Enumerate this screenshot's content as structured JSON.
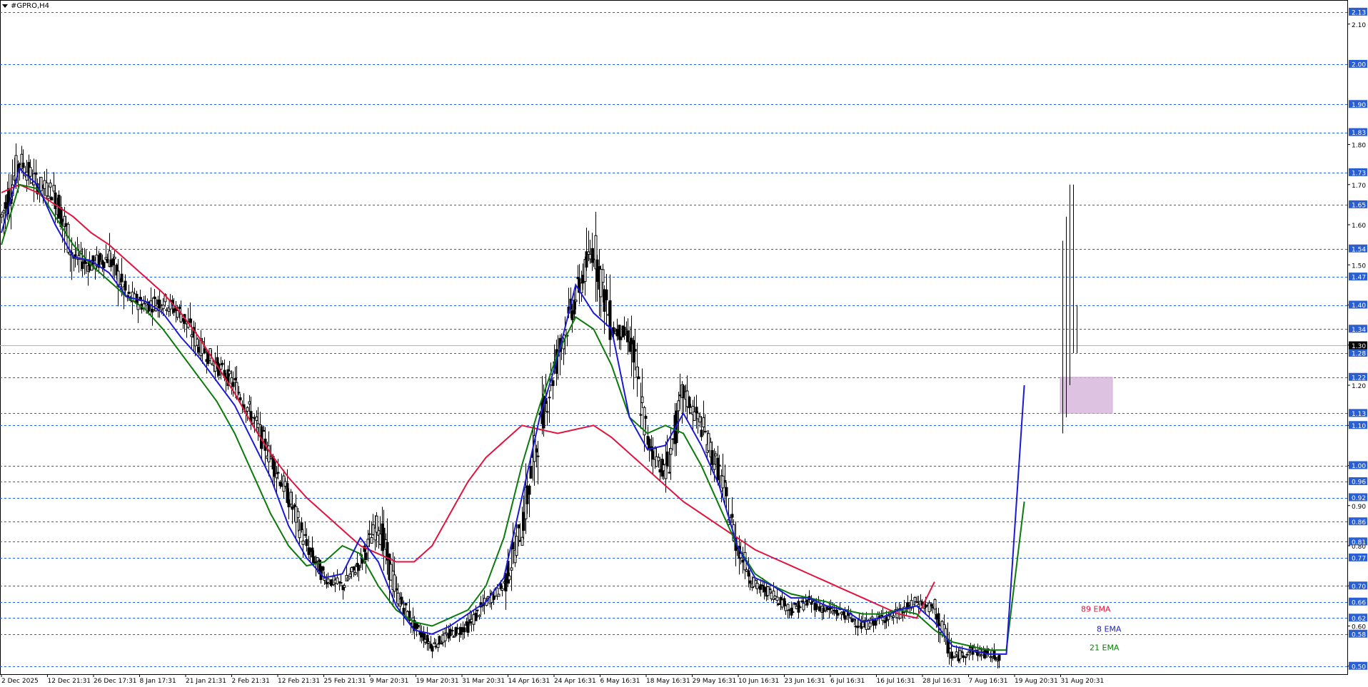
{
  "window": {
    "symbol": "#GPRO,H4"
  },
  "colors": {
    "grid": "#2a5fd3",
    "ema8": "#1a1ad6",
    "ema21": "#0a7a0a",
    "ema89": "#e0143c",
    "zone": "#d8b8dc",
    "current_price_bg": "#000000"
  },
  "price_axis": {
    "min": 0.48,
    "max": 2.16,
    "levels": [
      "2.13",
      "2.00",
      "1.90",
      "1.83",
      "1.73",
      "1.65",
      "1.54",
      "1.47",
      "1.40",
      "1.34",
      "1.28",
      "1.22",
      "1.13",
      "1.10",
      "1.00",
      "0.96",
      "0.92",
      "0.86",
      "0.81",
      "0.77",
      "0.70",
      "0.66",
      "0.62",
      "0.58",
      "0.50"
    ],
    "ticks": [
      "2.10",
      "1.80",
      "1.70",
      "1.60",
      "1.50",
      "1.40",
      "1.30",
      "1.20",
      "1.10",
      "1.00",
      "0.90",
      "0.80",
      "0.70",
      "0.60",
      "0.50"
    ],
    "current_price": "1.30"
  },
  "time_axis": {
    "labels": [
      "2 Dec 2025",
      "12 Dec 21:31",
      "26 Dec 17:31",
      "8 Jan 17:31",
      "21 Jan 21:31",
      "2 Feb 21:31",
      "12 Feb 21:31",
      "25 Feb 21:31",
      "9 Mar 20:31",
      "19 Mar 20:31",
      "31 Mar 20:31",
      "14 Apr 16:31",
      "24 Apr 16:31",
      "6 May 16:31",
      "18 May 16:31",
      "29 May 16:31",
      "10 Jun 16:31",
      "23 Jun 16:31",
      "6 Jul 16:31",
      "16 Jul 16:31",
      "28 Jul 16:31",
      "7 Aug 16:31",
      "19 Aug 20:31",
      "31 Aug 20:31"
    ]
  },
  "legend": {
    "ema89": "89 EMA",
    "ema8": "8 EMA",
    "ema21": "21 EMA"
  },
  "chart_data": {
    "type": "line",
    "title": "#GPRO,H4",
    "ylim": [
      0.48,
      2.16
    ],
    "x": [
      0,
      10,
      20,
      30,
      40,
      50,
      60,
      70,
      80,
      90,
      100,
      110,
      120,
      130,
      140,
      150,
      160,
      170,
      180,
      190,
      200,
      210,
      220,
      230,
      240,
      250,
      260,
      270,
      280,
      290,
      300,
      310,
      320,
      330,
      340,
      350,
      360,
      370,
      380,
      390,
      400,
      410,
      420,
      430,
      440,
      450,
      460,
      470,
      480,
      490,
      500,
      510,
      520,
      530,
      540,
      550,
      560,
      570,
      580,
      590,
      600
    ],
    "price": [
      1.62,
      1.76,
      1.7,
      1.68,
      1.52,
      1.5,
      1.52,
      1.42,
      1.4,
      1.41,
      1.38,
      1.3,
      1.25,
      1.2,
      1.12,
      1.02,
      0.92,
      0.8,
      0.72,
      0.7,
      0.76,
      0.86,
      0.68,
      0.6,
      0.55,
      0.58,
      0.6,
      0.66,
      0.7,
      0.85,
      1.1,
      1.28,
      1.42,
      1.55,
      1.34,
      1.32,
      1.06,
      0.98,
      1.18,
      1.1,
      0.98,
      0.8,
      0.7,
      0.68,
      0.64,
      0.66,
      0.64,
      0.63,
      0.6,
      0.62,
      0.63,
      0.66,
      0.64,
      0.52,
      0.54,
      0.53,
      0.52,
      1.45,
      1.3,
      1.3,
      1.3
    ],
    "series": [
      {
        "name": "8 EMA",
        "values": [
          1.58,
          1.74,
          1.7,
          1.6,
          1.52,
          1.51,
          1.48,
          1.42,
          1.41,
          1.38,
          1.32,
          1.27,
          1.21,
          1.15,
          1.06,
          0.97,
          0.85,
          0.77,
          0.72,
          0.73,
          0.82,
          0.76,
          0.65,
          0.59,
          0.58,
          0.6,
          0.63,
          0.66,
          0.72,
          0.92,
          1.12,
          1.27,
          1.45,
          1.38,
          1.34,
          1.12,
          1.04,
          1.05,
          1.13,
          1.05,
          0.95,
          0.8,
          0.72,
          0.7,
          0.67,
          0.67,
          0.65,
          0.64,
          0.61,
          0.62,
          0.64,
          0.65,
          0.61,
          0.55,
          0.54,
          0.53,
          0.53,
          1.2,
          null,
          null,
          null
        ]
      },
      {
        "name": "21 EMA",
        "values": [
          1.55,
          1.7,
          1.69,
          1.62,
          1.55,
          1.5,
          1.46,
          1.42,
          1.39,
          1.34,
          1.28,
          1.22,
          1.16,
          1.08,
          0.98,
          0.88,
          0.8,
          0.75,
          0.76,
          0.8,
          0.78,
          0.7,
          0.64,
          0.61,
          0.6,
          0.62,
          0.64,
          0.7,
          0.82,
          1.0,
          1.15,
          1.28,
          1.37,
          1.34,
          1.25,
          1.12,
          1.08,
          1.1,
          1.08,
          1.0,
          0.9,
          0.8,
          0.73,
          0.7,
          0.68,
          0.67,
          0.66,
          0.64,
          0.63,
          0.63,
          0.64,
          0.63,
          0.59,
          0.56,
          0.55,
          0.54,
          0.54,
          0.91,
          null,
          null,
          null
        ]
      },
      {
        "name": "89 EMA",
        "values": [
          1.68,
          1.7,
          1.68,
          1.65,
          1.62,
          1.58,
          1.55,
          1.51,
          1.47,
          1.43,
          1.38,
          1.32,
          1.25,
          1.18,
          1.1,
          1.03,
          0.97,
          0.92,
          0.88,
          0.84,
          0.8,
          0.78,
          0.76,
          0.76,
          0.8,
          0.88,
          0.96,
          1.02,
          1.06,
          1.1,
          1.09,
          1.08,
          1.09,
          1.1,
          1.07,
          1.03,
          0.99,
          0.95,
          0.91,
          0.88,
          0.85,
          0.82,
          0.79,
          0.77,
          0.75,
          0.73,
          0.71,
          0.69,
          0.67,
          0.65,
          0.63,
          0.62,
          0.71,
          null,
          null,
          null,
          null,
          null,
          null,
          null,
          null
        ]
      }
    ],
    "zone": {
      "from": 1.13,
      "to": 1.22
    },
    "current_price": 1.3,
    "grid": true
  }
}
